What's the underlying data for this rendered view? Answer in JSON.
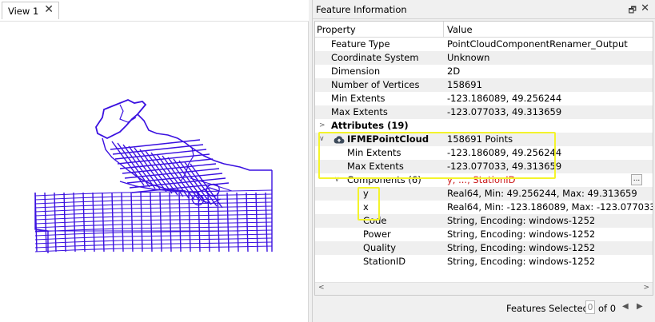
{
  "view": {
    "tab_label": "View 1",
    "close_glyph": "✕"
  },
  "panel": {
    "title": "Feature Information",
    "pin_glyph": "🗗",
    "close_glyph": "✕",
    "columns": {
      "property": "Property",
      "value": "Value"
    }
  },
  "rows": {
    "feature_type": {
      "k": "Feature Type",
      "v": "PointCloudComponentRenamer_Output"
    },
    "coord_system": {
      "k": "Coordinate System",
      "v": "Unknown"
    },
    "dimension": {
      "k": "Dimension",
      "v": "2D"
    },
    "num_vertices": {
      "k": "Number of Vertices",
      "v": "158691"
    },
    "min_extents": {
      "k": "Min Extents",
      "v": "-123.186089, 49.256244"
    },
    "max_extents": {
      "k": "Max Extents",
      "v": "-123.077033, 49.313659"
    },
    "attributes": {
      "k": "Attributes (19)"
    },
    "pointcloud": {
      "k": "IFMEPointCloud",
      "v": "158691 Points"
    },
    "pc_min": {
      "k": "Min Extents",
      "v": "-123.186089, 49.256244"
    },
    "pc_max": {
      "k": "Max Extents",
      "v": "-123.077033, 49.313659"
    },
    "components": {
      "k": "Components (6)",
      "v": "y, ..., StationID",
      "btn": "..."
    },
    "comp_y": {
      "k": "y",
      "v": "Real64, Min: 49.256244, Max: 49.313659"
    },
    "comp_x": {
      "k": "x",
      "v": "Real64, Min: -123.186089, Max: -123.077033"
    },
    "comp_code": {
      "k": "Code",
      "v": "String, Encoding: windows-1252"
    },
    "comp_power": {
      "k": "Power",
      "v": "String, Encoding: windows-1252"
    },
    "comp_quality": {
      "k": "Quality",
      "v": "String, Encoding: windows-1252"
    },
    "comp_station": {
      "k": "StationID",
      "v": "String, Encoding: windows-1252"
    }
  },
  "footer": {
    "label": "Features Selected:",
    "count": "0",
    "of": "of 0",
    "prev": "◀",
    "next": "▶"
  },
  "colors": {
    "map_lines": "#3a10e0",
    "highlight": "#f4f42c",
    "red_text": "#cc1a1a"
  },
  "icons": {
    "pointcloud": "cloud-upload-icon",
    "expand": "chevron-right-icon",
    "collapse": "chevron-down-icon"
  }
}
